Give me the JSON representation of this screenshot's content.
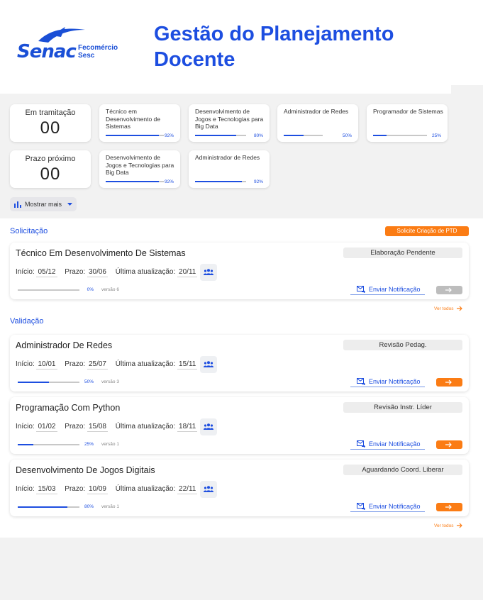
{
  "brand": {
    "logo_text": "Senac",
    "partner_line1": "Fecomércio",
    "partner_line2": "Sesc"
  },
  "page": {
    "title_line1": "Gestão do Planejamento",
    "title_line2": "Docente"
  },
  "counters": [
    {
      "label": "Em tramitação",
      "value": "00"
    },
    {
      "label": "Prazo próximo",
      "value": "00"
    }
  ],
  "course_progress": [
    {
      "name": "Técnico em Desenvolvimento de Sistemas",
      "percent_label": "92%",
      "percent": 92
    },
    {
      "name": "Desenvolvimento de Jogos e Tecnologias para Big Data",
      "percent_label": "80%",
      "percent": 80
    },
    {
      "name": "Administrador de Redes",
      "percent_label": "50%",
      "percent": 50
    },
    {
      "name": "Programador de Sistemas",
      "percent_label": "25%",
      "percent": 25
    },
    {
      "name": "Desenvolvimento de Jogos e Tecnologias para Big Data",
      "percent_label": "92%",
      "percent": 92
    },
    {
      "name": "Administrador de Redes",
      "percent_label": "92%",
      "percent": 92
    }
  ],
  "show_more": {
    "label": "Mostrar mais",
    "icon": "bar-chart-icon"
  },
  "labels": {
    "inicio": "Início:",
    "prazo": "Prazo:",
    "ultima": "Última atualização:",
    "notify": "Enviar Notificação",
    "see_all": "Ver todos"
  },
  "solicitacao": {
    "title": "Solicitação",
    "cta_label": "Solicite Criação de PTD",
    "items": [
      {
        "name": "Técnico Em Desenvolvimento De Sistemas",
        "status": "Elaboração Pendente",
        "inicio": "05/12",
        "prazo": "30/06",
        "ultima": "20/11",
        "percent_label": "0%",
        "percent": 0,
        "version": "versão 6",
        "action_enabled": false
      }
    ]
  },
  "validacao": {
    "title": "Validação",
    "items": [
      {
        "name": "Administrador De Redes",
        "status": "Revisão Pedag.",
        "inicio": "10/01",
        "prazo": "25/07",
        "ultima": "15/11",
        "percent_label": "50%",
        "percent": 50,
        "version": "versão 3",
        "action_enabled": true
      },
      {
        "name": "Programação Com Python",
        "status": "Revisão Instr. Líder",
        "inicio": "01/02",
        "prazo": "15/08",
        "ultima": "18/11",
        "percent_label": "25%",
        "percent": 25,
        "version": "versão 1",
        "action_enabled": true
      },
      {
        "name": "Desenvolvimento De Jogos Digitais",
        "status": "Aguardando Coord. Liberar",
        "inicio": "15/03",
        "prazo": "10/09",
        "ultima": "22/11",
        "percent_label": "80%",
        "percent": 80,
        "version": "versão 1",
        "action_enabled": true
      }
    ]
  },
  "colors": {
    "primary": "#1d4ee0",
    "accent": "#fb7c14",
    "disabled": "#bdbdbd"
  }
}
